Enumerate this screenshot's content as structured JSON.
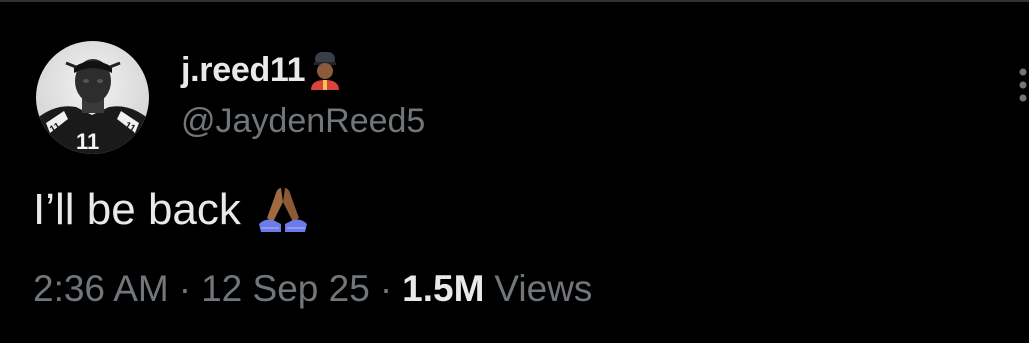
{
  "tweet": {
    "author": {
      "display_name": "j.reed11",
      "name_emoji": "guard-emoji",
      "handle": "@JaydenReed5",
      "avatar": "avatar-photo"
    },
    "text": "I’ll be back",
    "text_emoji": "folded-hands-emoji",
    "meta": {
      "time": "2:36 AM",
      "separator": "·",
      "date": "12 Sep 25",
      "views_count": "1.5M",
      "views_label": "Views"
    },
    "more_icon": "more-vertical-icon"
  },
  "colors": {
    "background": "#000000",
    "primary_text": "#e7e9ea",
    "secondary_text": "#71767b",
    "border": "#2f3336"
  }
}
